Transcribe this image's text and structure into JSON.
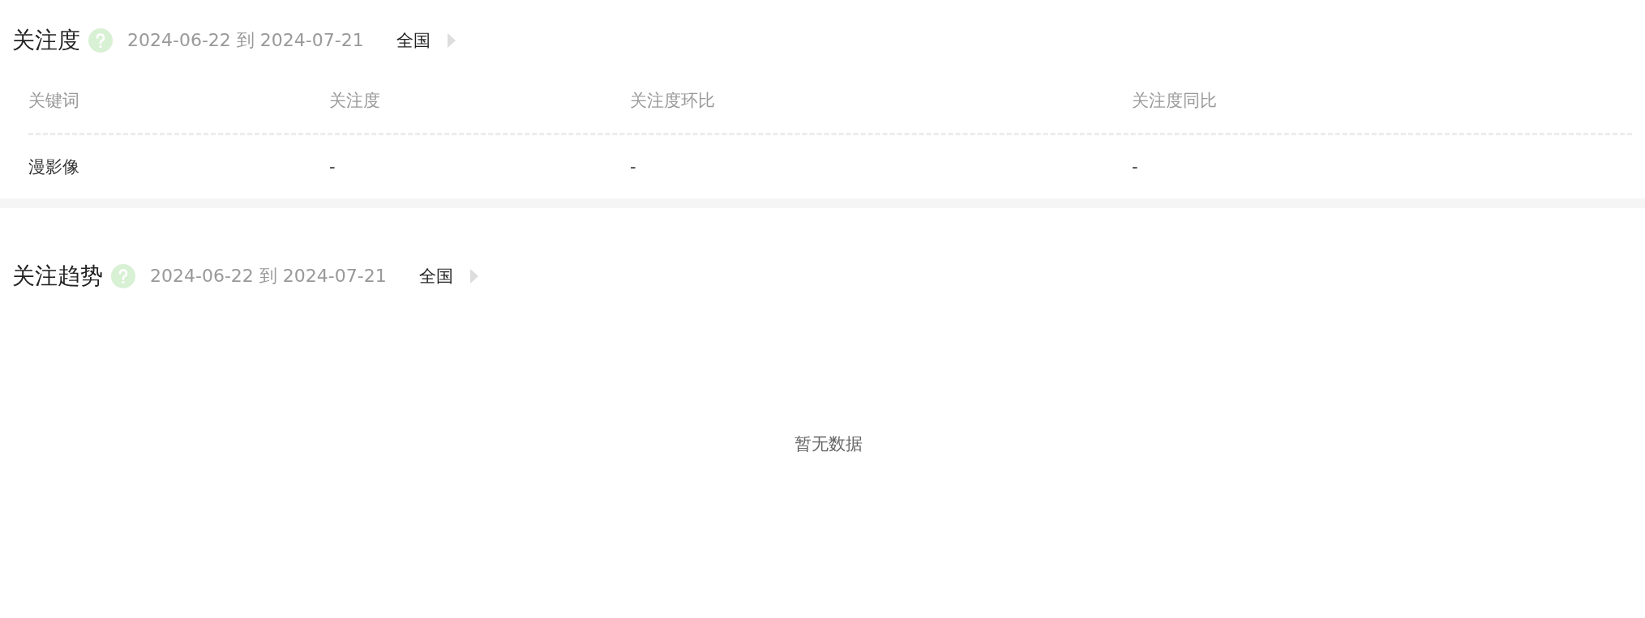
{
  "sections": [
    {
      "kind": "table",
      "title": "关注度",
      "date_range": "2024-06-22 到 2024-07-21",
      "region": "全国",
      "table": {
        "columns": [
          "关键词",
          "关注度",
          "关注度环比",
          "关注度同比"
        ],
        "rows": [
          [
            "漫影像",
            "-",
            "-",
            "-"
          ]
        ]
      }
    },
    {
      "kind": "trend",
      "title": "关注趋势",
      "date_range": "2024-06-22 到 2024-07-21",
      "region": "全国",
      "empty_text": "暂无数据"
    }
  ]
}
